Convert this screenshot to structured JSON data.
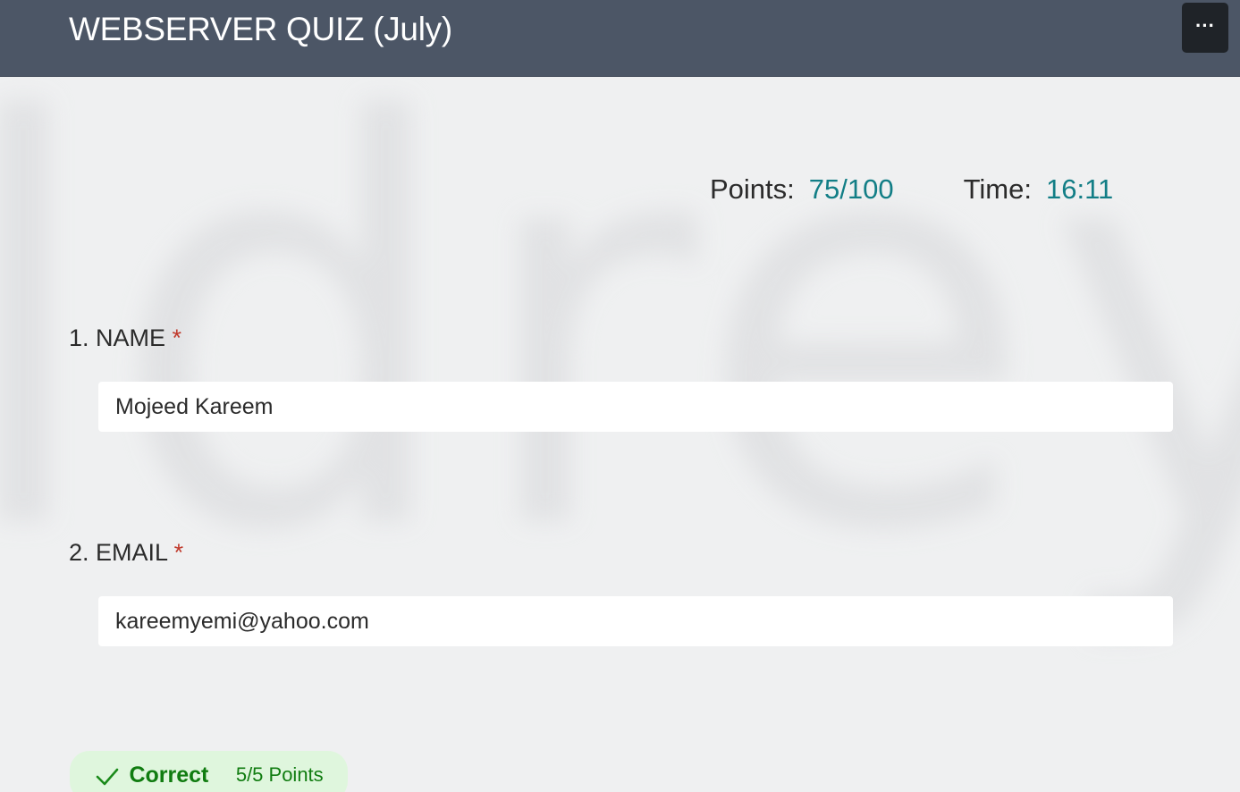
{
  "header": {
    "title": "WEBSERVER QUIZ (July)",
    "more_label": "···"
  },
  "score": {
    "points_label": "Points:",
    "points_value": "75/100",
    "time_label": "Time:",
    "time_value": "16:11"
  },
  "questions": [
    {
      "label": "1. NAME",
      "required_mark": "*",
      "answer": "Mojeed Kareem"
    },
    {
      "label": "2. EMAIL",
      "required_mark": "*",
      "answer": "kareemyemi@yahoo.com"
    }
  ],
  "result": {
    "status": "Correct",
    "points": "5/5 Points"
  },
  "colors": {
    "header_bg": "#4c5666",
    "accent_value": "#127e86",
    "required": "#c0392b",
    "correct_bg": "#dff6dd",
    "correct_text": "#107c10"
  },
  "icons": {
    "more": "more-horizontal-icon",
    "check": "check-icon"
  }
}
